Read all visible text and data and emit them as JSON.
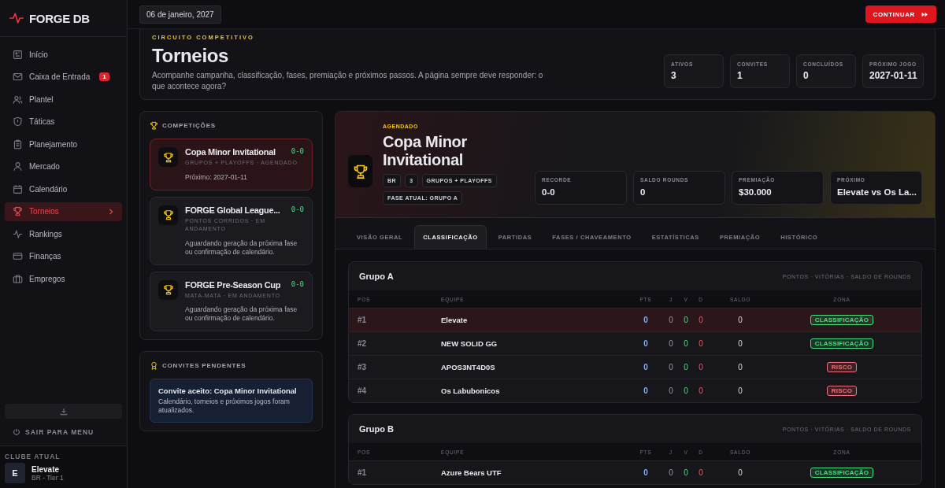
{
  "brand": {
    "name": "FORGE DB"
  },
  "nav": [
    {
      "label": "Início",
      "selected": false
    },
    {
      "label": "Caixa de Entrada",
      "badge": "1",
      "selected": false
    },
    {
      "label": "Plantel",
      "selected": false
    },
    {
      "label": "Táticas",
      "selected": false
    },
    {
      "label": "Planejamento",
      "selected": false
    },
    {
      "label": "Mercado",
      "selected": false
    },
    {
      "label": "Calendário",
      "selected": false
    },
    {
      "label": "Torneios",
      "selected": true
    },
    {
      "label": "Rankings",
      "selected": false
    },
    {
      "label": "Finanças",
      "selected": false
    },
    {
      "label": "Empregos",
      "selected": false
    }
  ],
  "sidebar_footer": {
    "exit_label": "SAIR PARA MENU"
  },
  "club": {
    "caption": "CLUBE ATUAL",
    "initial": "E",
    "name": "Elevate",
    "meta": "BR - Tier 1"
  },
  "topbar": {
    "date": "06 de janeiro, 2027",
    "continue_label": "CONTINUAR"
  },
  "header": {
    "eyebrow": "CIRCUITO COMPETITIVO",
    "title": "Torneios",
    "description": "Acompanhe campanha, classificação, fases, premiação e próximos passos. A página sempre deve responder: o que acontece agora?",
    "stats": [
      {
        "label": "ATIVOS",
        "value": "3"
      },
      {
        "label": "CONVITES",
        "value": "1"
      },
      {
        "label": "CONCLUÍDOS",
        "value": "0"
      },
      {
        "label": "PRÓXIMO JOGO",
        "value": "2027-01-11"
      }
    ]
  },
  "competitions": {
    "title": "COMPETIÇÕES",
    "items": [
      {
        "name": "Copa Minor Invitational",
        "score": "0-0",
        "meta": "GRUPOS + PLAYOFFS · AGENDADO",
        "note": "Próximo: 2027-01-11",
        "selected": true
      },
      {
        "name": "FORGE Global League...",
        "score": "0-0",
        "meta": "PONTOS CORRIDOS · EM ANDAMENTO",
        "note": "Aguardando geração da próxima fase ou confirmação de calendário.",
        "selected": false
      },
      {
        "name": "FORGE Pre-Season Cup",
        "score": "0-0",
        "meta": "MATA-MATA · EM ANDAMENTO",
        "note": "Aguardando geração da próxima fase ou confirmação de calendário.",
        "selected": false
      }
    ]
  },
  "invites": {
    "title": "CONVITES PENDENTES",
    "items": [
      {
        "title": "Convite aceito: Copa Minor Invitational",
        "text": "Calendário, torneios e próximos jogos foram atualizados."
      }
    ]
  },
  "detail": {
    "status": "AGENDADO",
    "title": "Copa Minor Invitational",
    "tags": [
      "BR",
      "3",
      "GRUPOS + PLAYOFFS",
      "FASE ATUAL: GRUPO A"
    ],
    "stats": [
      {
        "label": "RECORDE",
        "value": "0-0"
      },
      {
        "label": "SALDO ROUNDS",
        "value": "0"
      },
      {
        "label": "PREMIAÇÃO",
        "value": "$30.000"
      },
      {
        "label": "PRÓXIMO",
        "value": "Elevate vs Os La..."
      }
    ],
    "tabs": [
      {
        "label": "VISÃO GERAL",
        "selected": false
      },
      {
        "label": "CLASSIFICAÇÃO",
        "selected": true
      },
      {
        "label": "PARTIDAS",
        "selected": false
      },
      {
        "label": "FASES / CHAVEAMENTO",
        "selected": false
      },
      {
        "label": "ESTATÍSTICAS",
        "selected": false
      },
      {
        "label": "PREMIAÇÃO",
        "selected": false
      },
      {
        "label": "HISTÓRICO",
        "selected": false
      }
    ],
    "groups": [
      {
        "name": "Grupo A",
        "legend": "PONTOS · VITÓRIAS · SALDO DE ROUNDS",
        "columns": [
          "POS",
          "EQUIPE",
          "PTS",
          "J",
          "V",
          "D",
          "SALDO",
          "ZONA"
        ],
        "rows": [
          {
            "pos": "#1",
            "team": "Elevate",
            "pts": "0",
            "j": "0",
            "v": "0",
            "d": "0",
            "saldo": "0",
            "zone": {
              "label": "CLASSIFICAÇÃO",
              "color": "#4ade80"
            },
            "selected": true
          },
          {
            "pos": "#2",
            "team": "NEW SOLID GG",
            "pts": "0",
            "j": "0",
            "v": "0",
            "d": "0",
            "saldo": "0",
            "zone": {
              "label": "CLASSIFICAÇÃO",
              "color": "#4ade80"
            },
            "selected": false
          },
          {
            "pos": "#3",
            "team": "APOS3NT4D0S",
            "pts": "0",
            "j": "0",
            "v": "0",
            "d": "0",
            "saldo": "0",
            "zone": {
              "label": "RISCO",
              "color": "#f0707a"
            },
            "selected": false
          },
          {
            "pos": "#4",
            "team": "Os Labubonicos",
            "pts": "0",
            "j": "0",
            "v": "0",
            "d": "0",
            "saldo": "0",
            "zone": {
              "label": "RISCO",
              "color": "#f0707a"
            },
            "selected": false
          }
        ]
      },
      {
        "name": "Grupo B",
        "legend": "PONTOS · VITÓRIAS · SALDO DE ROUNDS",
        "columns": [
          "POS",
          "EQUIPE",
          "PTS",
          "J",
          "V",
          "D",
          "SALDO",
          "ZONA"
        ],
        "rows": [
          {
            "pos": "#1",
            "team": "Azure Bears UTF",
            "pts": "0",
            "j": "0",
            "v": "0",
            "d": "0",
            "saldo": "0",
            "zone": {
              "label": "CLASSIFICAÇÃO",
              "color": "#4ade80"
            },
            "selected": false
          }
        ]
      }
    ]
  }
}
